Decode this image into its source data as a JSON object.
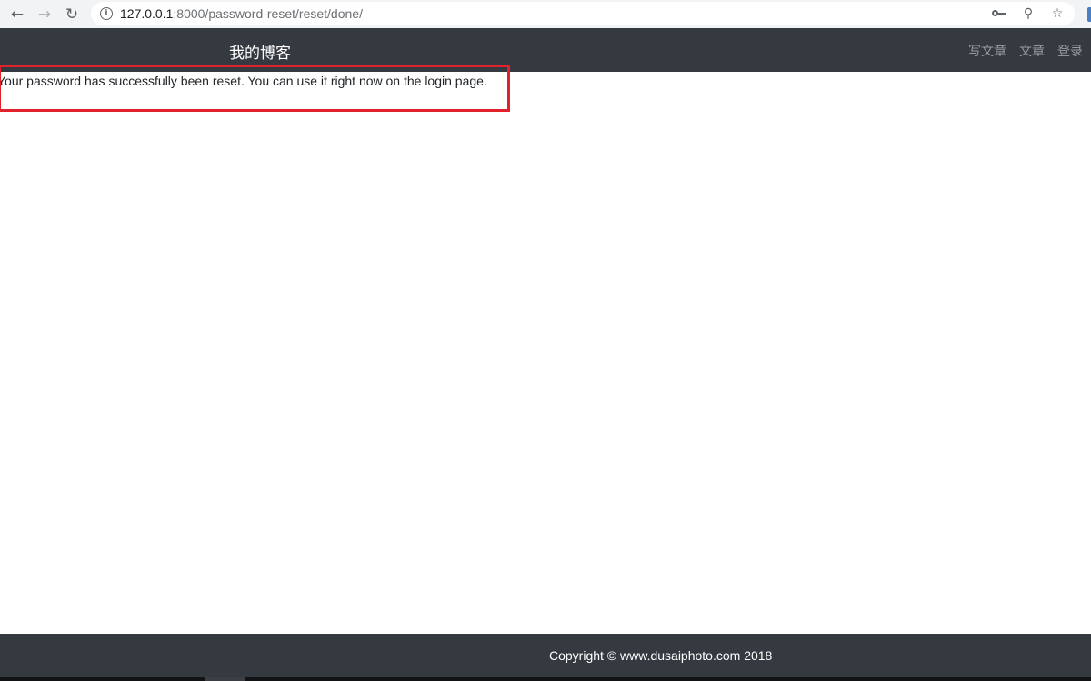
{
  "browser": {
    "url_host": "127.0.0.1",
    "url_path": ":8000/password-reset/reset/done/",
    "back_icon": "arrow-left-icon",
    "forward_icon": "arrow-right-icon",
    "reload_icon": "reload-icon",
    "site_info_icon": "info-icon",
    "password_key_icon": "key-icon",
    "zoom_icon": "zoom-out-icon",
    "bookmark_icon": "star-icon"
  },
  "navbar": {
    "brand": "我的博客",
    "links": [
      "写文章",
      "文章",
      "登录"
    ],
    "background": "#343a40"
  },
  "main": {
    "message": "Your password has successfully been reset. You can use it right now on the login page.",
    "highlight_color": "#e0222a"
  },
  "footer": {
    "copyright": "Copyright © www.dusaiphoto.com 2018"
  }
}
